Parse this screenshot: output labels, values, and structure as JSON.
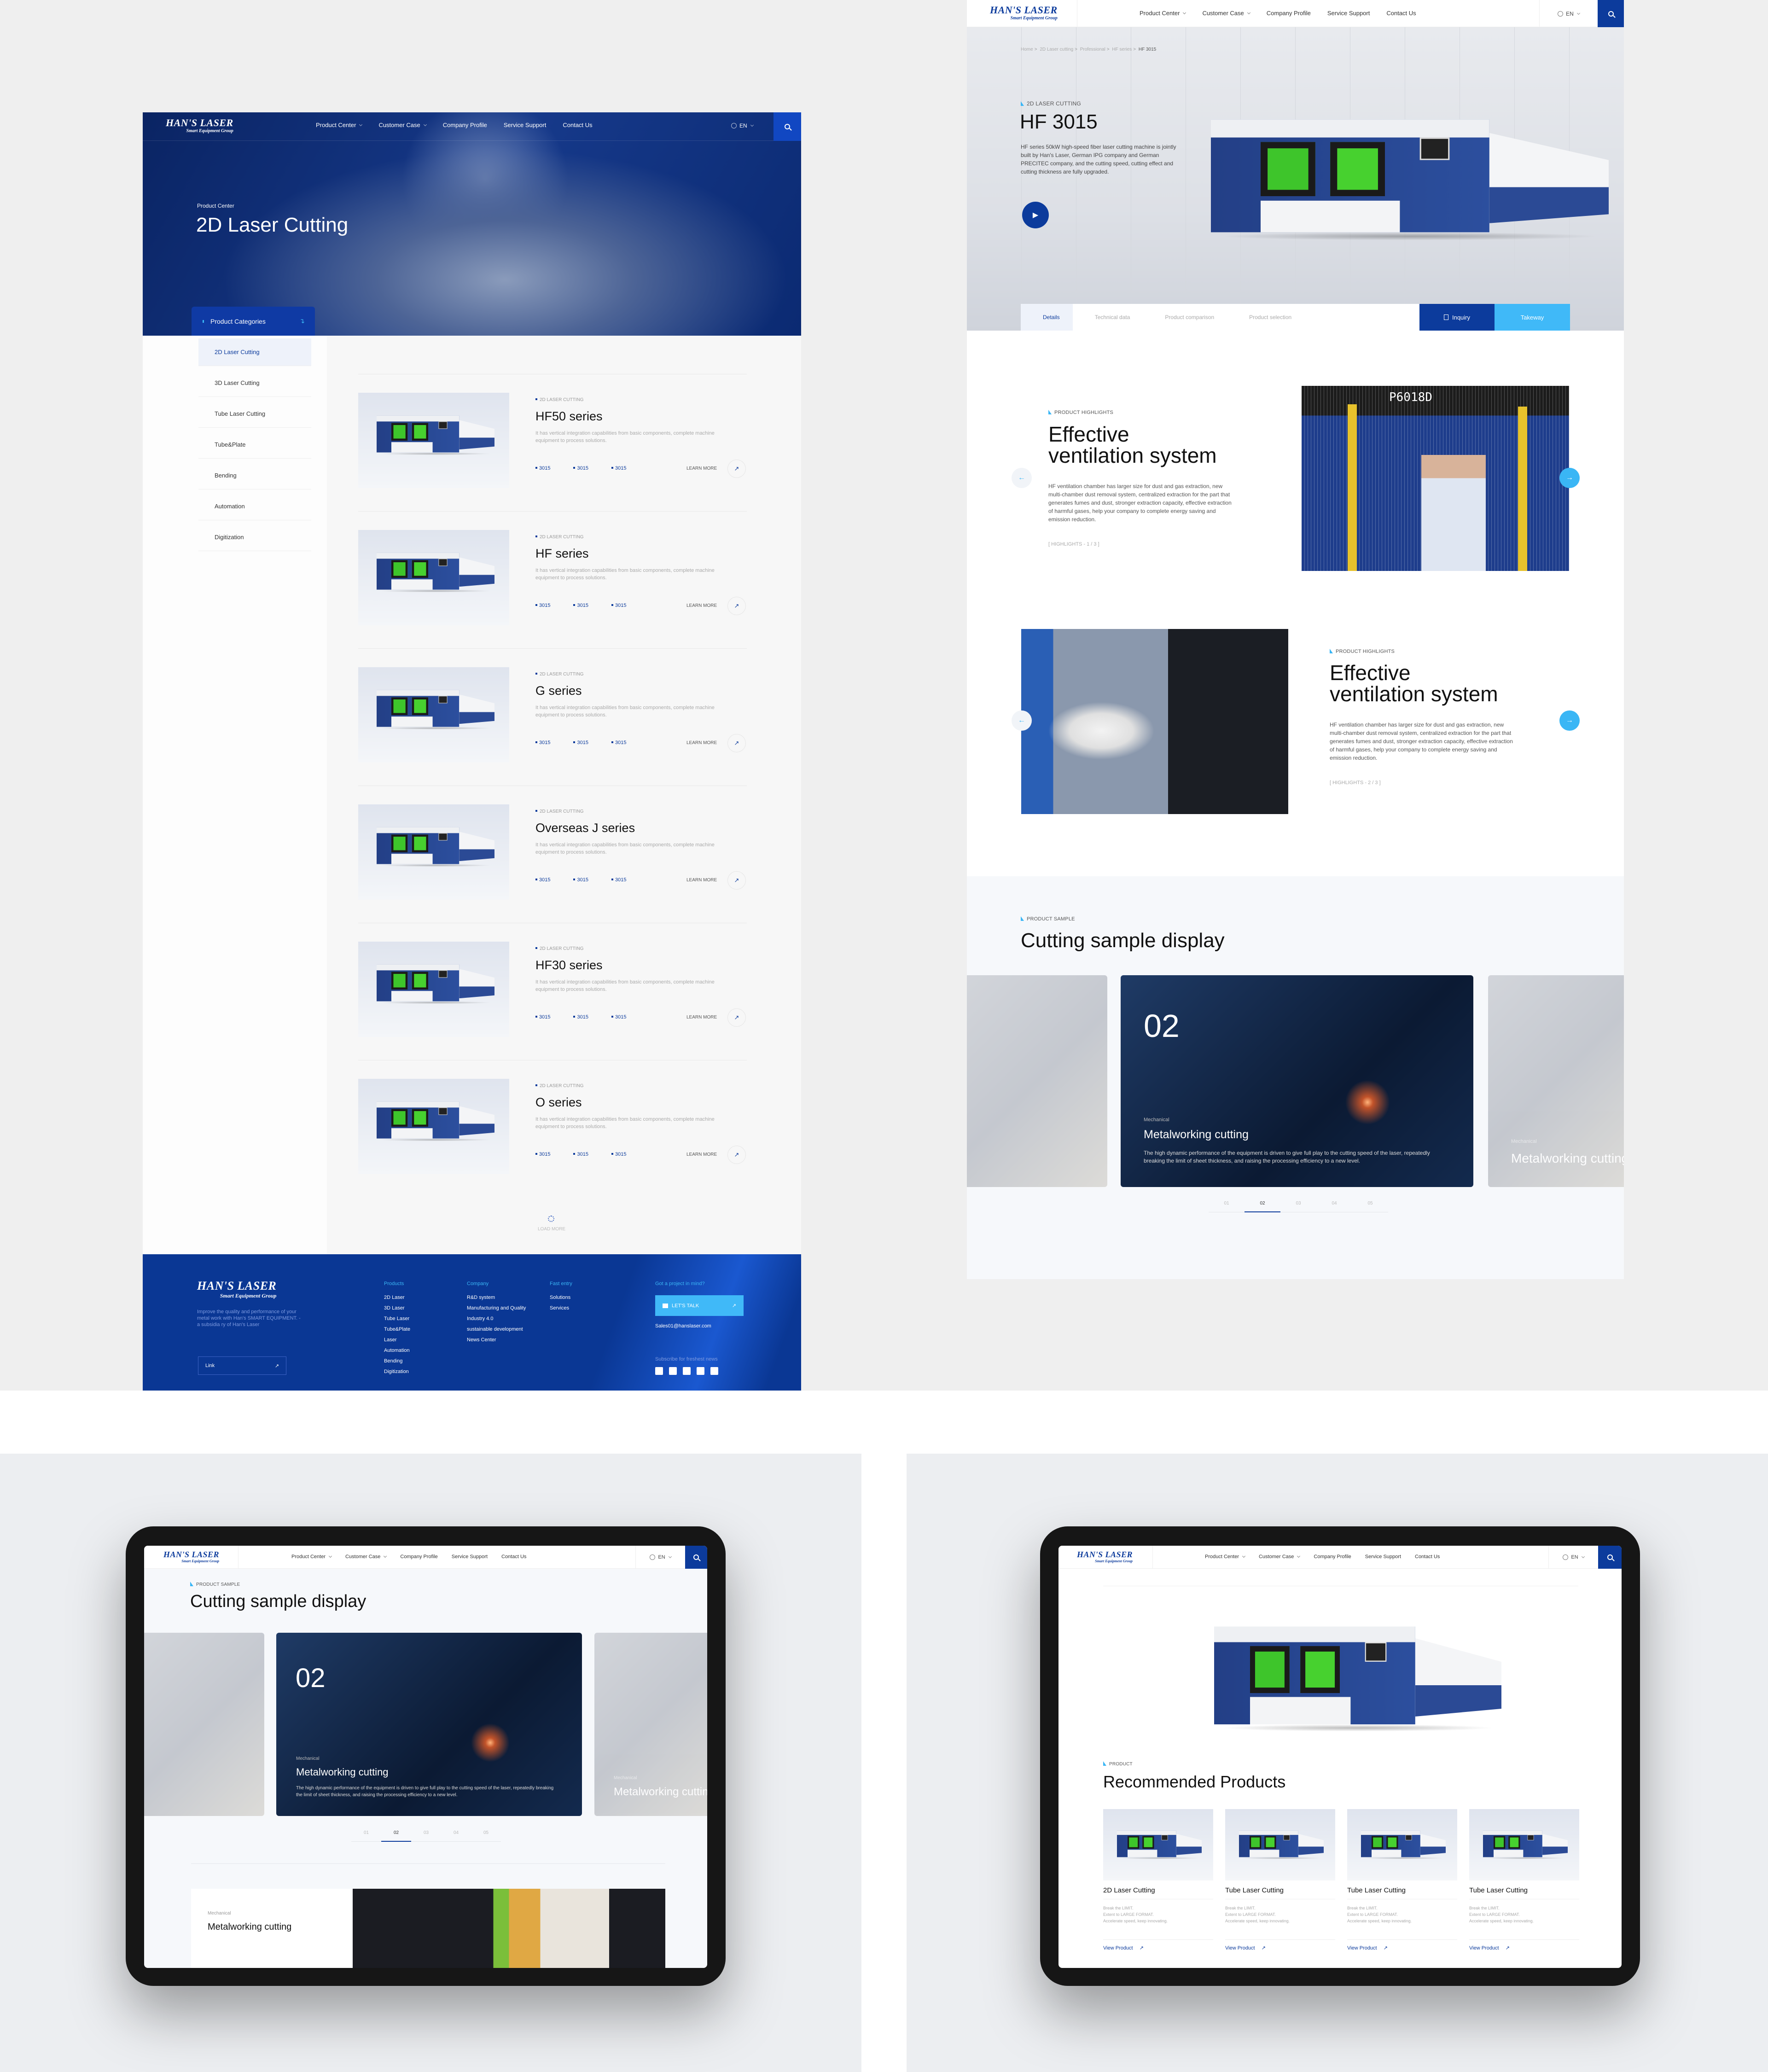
{
  "colors": {
    "brand_blue": "#0c3b9c",
    "accent_light_blue": "#3ab6f5",
    "footer_blue": "#0a3794",
    "text_dark": "#111111"
  },
  "brand": {
    "name": "HAN'S LASER",
    "tagline": "Smart Equipment Group"
  },
  "nav": {
    "items": [
      {
        "label": "Product Center",
        "dropdown": true
      },
      {
        "label": "Customer Case",
        "dropdown": true
      },
      {
        "label": "Company Profile",
        "dropdown": false
      },
      {
        "label": "Service Support",
        "dropdown": false
      },
      {
        "label": "Contact Us",
        "dropdown": false
      }
    ],
    "language": "EN",
    "icons": {
      "language": "globe-icon",
      "search": "search-icon"
    }
  },
  "list_page": {
    "hero": {
      "eyebrow": "Product Center",
      "title": "2D Laser Cutting"
    },
    "categories_label": "Product Categories",
    "sidebar": {
      "items": [
        {
          "label": "2D Laser Cutting",
          "active": true
        },
        {
          "label": "3D Laser Cutting"
        },
        {
          "label": "Tube Laser Cutting"
        },
        {
          "label": "Tube&Plate"
        },
        {
          "label": "Bending"
        },
        {
          "label": "Automation"
        },
        {
          "label": "Digitization"
        }
      ]
    },
    "products": [
      {
        "category": "2D LASER CUTTING",
        "title": "HF50 series",
        "description": "It has vertical integration capabilities from basic components, complete machine equipment to process solutions.",
        "specs": [
          "3015",
          "3015",
          "3015"
        ],
        "cta": "LEARN MORE"
      },
      {
        "category": "2D LASER CUTTING",
        "title": "HF series",
        "description": "It has vertical integration capabilities from basic components, complete machine equipment to process solutions.",
        "specs": [
          "3015",
          "3015",
          "3015"
        ],
        "cta": "LEARN MORE"
      },
      {
        "category": "2D LASER CUTTING",
        "title": "G series",
        "description": "It has vertical integration capabilities from basic components, complete machine equipment to process solutions.",
        "specs": [
          "3015",
          "3015",
          "3015"
        ],
        "cta": "LEARN MORE"
      },
      {
        "category": "2D LASER CUTTING",
        "title": "Overseas J series",
        "description": "It has vertical integration capabilities from basic components, complete machine equipment to process solutions.",
        "specs": [
          "3015",
          "3015",
          "3015"
        ],
        "cta": "LEARN MORE"
      },
      {
        "category": "2D LASER CUTTING",
        "title": "HF30 series",
        "description": "It has vertical integration capabilities from basic components, complete machine equipment to process solutions.",
        "specs": [
          "3015",
          "3015",
          "3015"
        ],
        "cta": "LEARN MORE"
      },
      {
        "category": "2D LASER CUTTING",
        "title": "O series",
        "description": "It has vertical integration capabilities from basic components, complete machine equipment to process solutions.",
        "specs": [
          "3015",
          "3015",
          "3015"
        ],
        "cta": "LEARN MORE"
      }
    ],
    "load_more": "LOAD MORE",
    "footer": {
      "description": "Improve the quality and performance of your metal work with Han's SMART EQUIPMENT. - a subsidia ry of Han's Laser",
      "link_label": "Link",
      "columns": [
        {
          "heading": "Products",
          "items": [
            "2D Laser",
            "3D Laser",
            "Tube Laser",
            "Tube&Plate",
            "Laser",
            "Automation",
            "Bending",
            "Digitization"
          ]
        },
        {
          "heading": "Company",
          "items": [
            "R&D system",
            "Manufacturing and Quality",
            "Industry 4.0",
            "sustainable development",
            "News Center"
          ]
        },
        {
          "heading": "Fast entry",
          "items": [
            "Solutions",
            "Services"
          ]
        }
      ],
      "cta_heading": "Got a project in mind?",
      "cta_button": "LET'S TALK",
      "email": "Sales01@hanslaser.com",
      "subscribe": "Subscribe for freshest news",
      "social": [
        "facebook-icon",
        "tiktok-icon",
        "linkedin-icon",
        "twitter-icon",
        "youtube-icon"
      ]
    }
  },
  "detail_page": {
    "breadcrumb": [
      "Home",
      "2D Laser cutting",
      "Professional",
      "HF series",
      "HF 3015"
    ],
    "hero": {
      "eyebrow": "2D LASER CUTTING",
      "title": "HF 3015",
      "description": "HF series 50kW high-speed fiber laser cutting machine is jointly built by Han's Laser, German IPG company and German PRECITEC company, and the cutting speed, cutting effect and cutting thickness are fully upgraded."
    },
    "tabs": [
      {
        "label": "Details",
        "active": true
      },
      {
        "label": "Technical data"
      },
      {
        "label": "Product comparison"
      },
      {
        "label": "Product selection"
      }
    ],
    "inquiry": "Inquiry",
    "takeaway": "Takeway",
    "highlights": [
      {
        "eyebrow": "PRODUCT HIGHLIGHTS",
        "title_line1": "Effective",
        "title_line2": "ventilation system",
        "description": "HF ventilation chamber has larger size for dust and gas extraction, new multi-chamber dust removal system, centralized extraction for the part that generates fumes and dust, stronger extraction capacity, effective extraction of harmful gases, help your company to complete energy saving and emission reduction.",
        "counter": "[ HIGHLIGHTS - 1 / 3 ]"
      },
      {
        "eyebrow": "PRODUCT HIGHLIGHTS",
        "title_line1": "Effective",
        "title_line2": "ventilation system",
        "description": "HF ventilation chamber has larger size for dust and gas extraction, new multi-chamber dust removal system, centralized extraction for the part that generates fumes and dust, stronger extraction capacity, effective extraction of harmful gases, help your company to complete energy saving and emission reduction.",
        "counter": "[ HIGHLIGHTS - 2 / 3 ]"
      }
    ],
    "machine_sign": "P6018D",
    "samples": {
      "eyebrow": "PRODUCT SAMPLE",
      "title": "Cutting sample display",
      "active": {
        "number": "02",
        "category": "Mechanical",
        "title": "Metalworking cutting",
        "description": "The high dynamic performance of the equipment is driven to give full play to the cutting speed of the laser, repeatedly breaking the limit of sheet thickness, and raising the processing efficiency to a new level."
      },
      "next": {
        "category": "Mechanical",
        "title": "Metalworking cutting"
      },
      "pages": [
        "01",
        "02",
        "03",
        "04",
        "05"
      ],
      "active_page": "02"
    }
  },
  "tablet_samples": {
    "feature": {
      "category": "Mechanical",
      "title": "Metalworking cutting"
    }
  },
  "tablet_recommended": {
    "eyebrow": "PRODUCT",
    "title": "Recommended Products",
    "items": [
      {
        "title": "2D Laser Cutting",
        "line1": "Break the LIMIT.",
        "line2": "Extent to LARGE FORMAT.",
        "line3": "Accelerate speed, keep innovating.",
        "cta": "View Product"
      },
      {
        "title": "Tube Laser Cutting",
        "line1": "Break the LIMIT.",
        "line2": "Extent to LARGE FORMAT.",
        "line3": "Accelerate speed, keep innovating.",
        "cta": "View Product"
      },
      {
        "title": "Tube Laser Cutting",
        "line1": "Break the LIMIT.",
        "line2": "Extent to LARGE FORMAT.",
        "line3": "Accelerate speed, keep innovating.",
        "cta": "View Product"
      },
      {
        "title": "Tube Laser Cutting",
        "line1": "Break the LIMIT.",
        "line2": "Extent to LARGE FORMAT.",
        "line3": "Accelerate speed, keep innovating.",
        "cta": "View Product"
      }
    ]
  }
}
